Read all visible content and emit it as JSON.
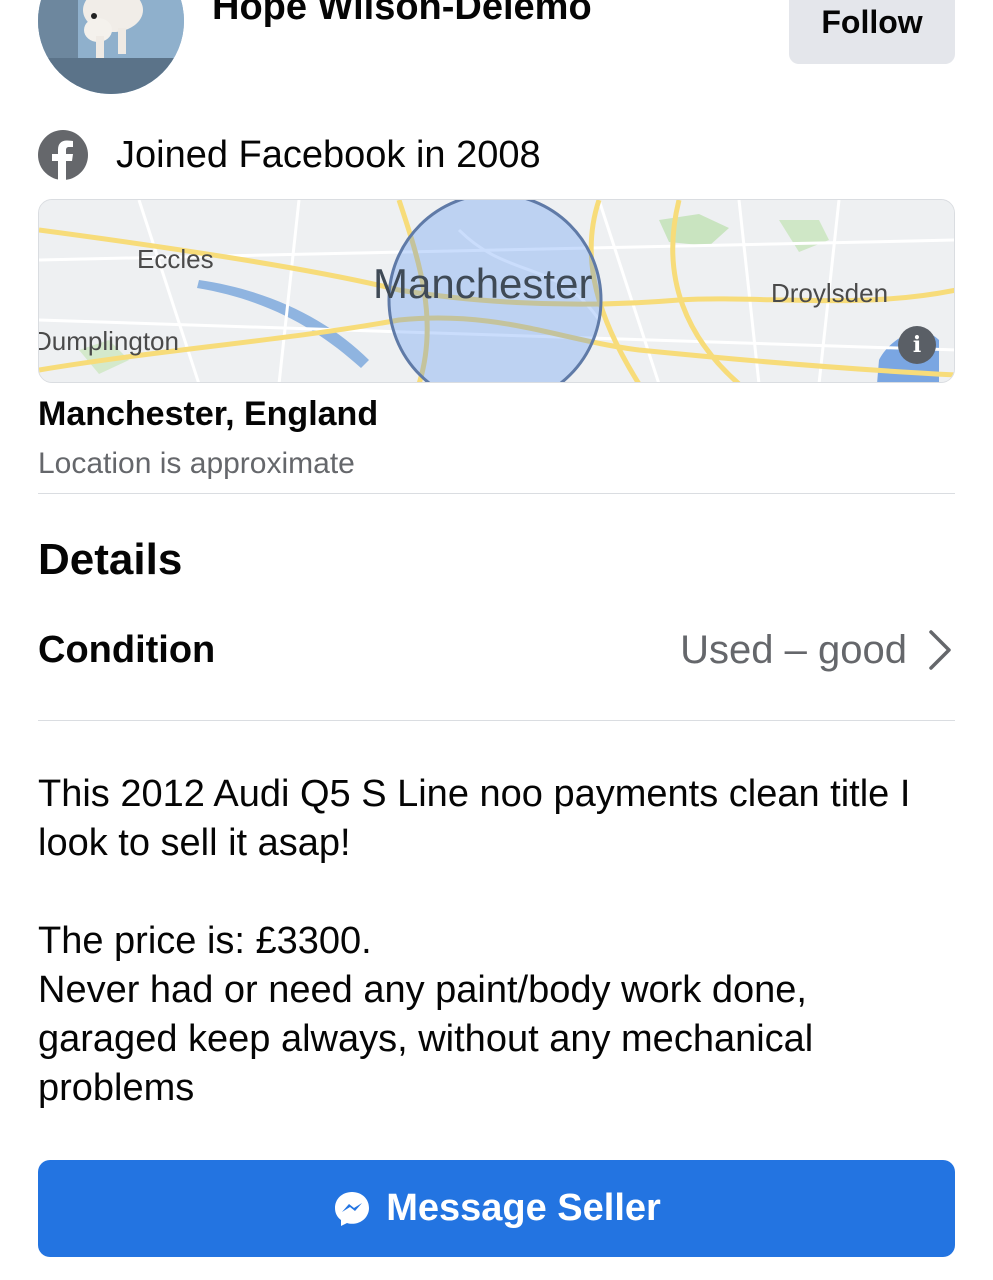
{
  "seller": {
    "name": "Hope Wilson-Delemo",
    "follow_label": "Follow",
    "joined_text": "Joined Facebook in 2008"
  },
  "map": {
    "labels": {
      "eccles": "Eccles",
      "manchester": "Manchester",
      "droylsden": "Droylsden",
      "dumplington": "Dumplington"
    },
    "info_icon": "i"
  },
  "location": {
    "title": "Manchester, England",
    "note": "Location is approximate"
  },
  "details": {
    "heading": "Details",
    "condition_label": "Condition",
    "condition_value": "Used – good"
  },
  "description": {
    "line1": "This 2012 Audi Q5 S Line noo payments clean title I look to sell it asap!",
    "line2": "The price is: £3300.",
    "line3": "Never had or need any paint/body work done, garaged keep always, without any mechanical problems"
  },
  "actions": {
    "message_label": "Message Seller"
  },
  "colors": {
    "primary": "#2374e1",
    "secondary_text": "#65676b",
    "divider": "#dadde1"
  },
  "icons": {
    "facebook": "facebook-icon",
    "messenger": "messenger-icon",
    "chevron": "chevron-right-icon",
    "info": "info-icon"
  }
}
